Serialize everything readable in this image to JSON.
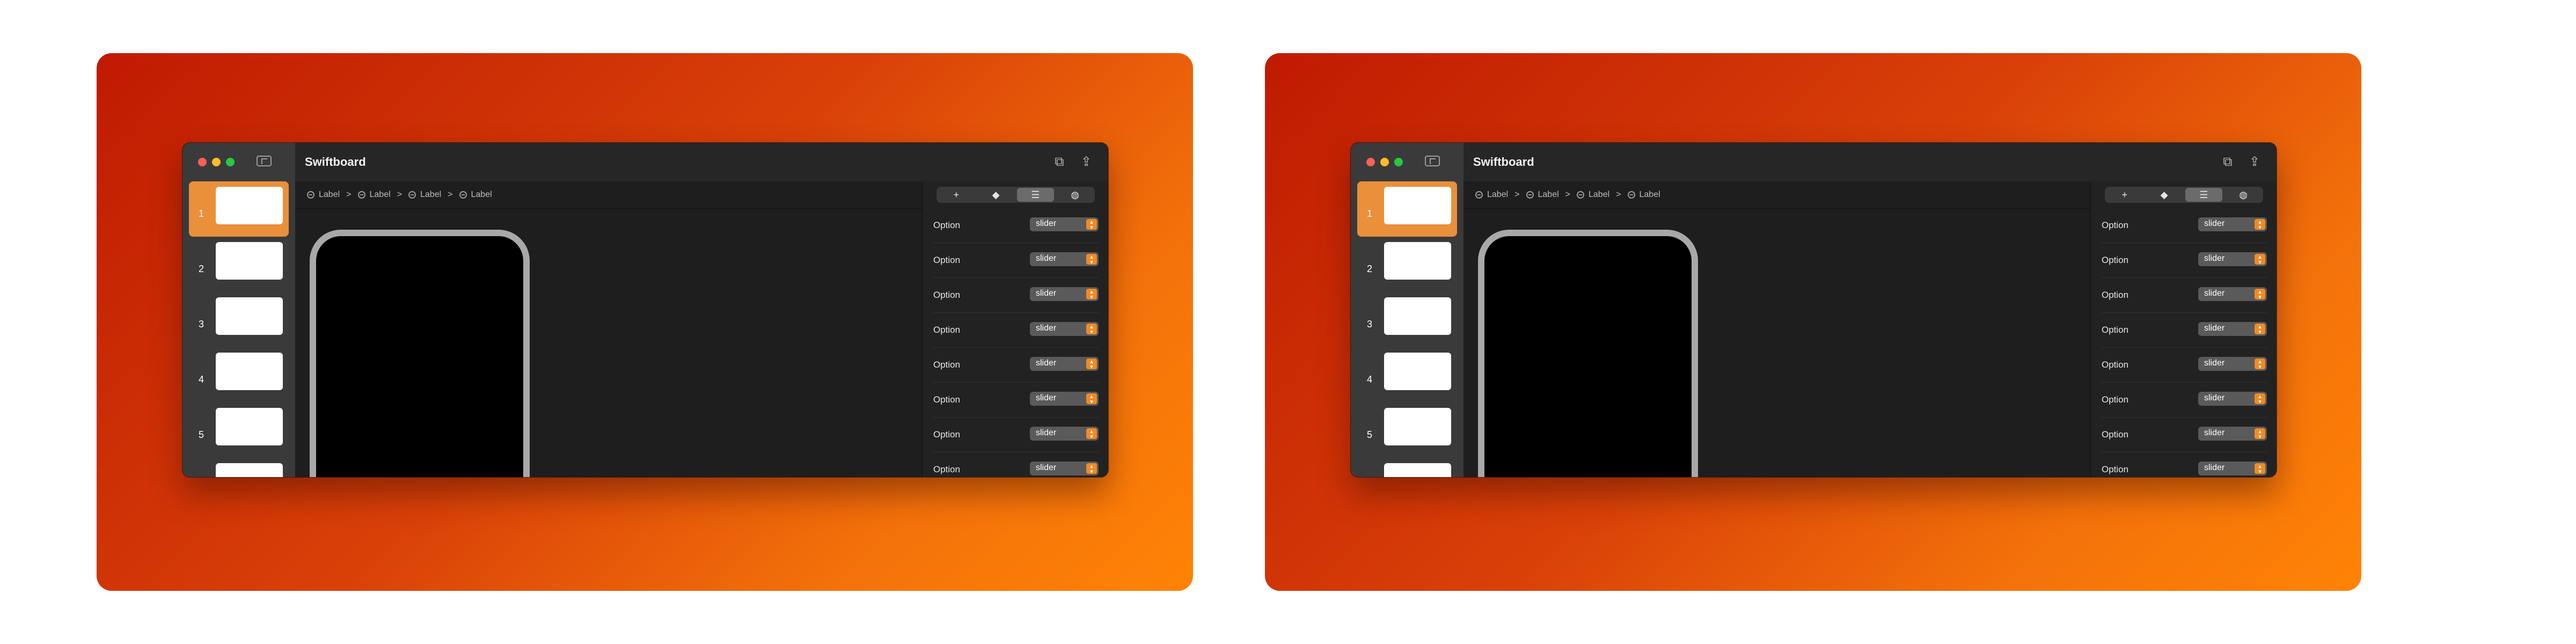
{
  "app": {
    "title": "Swiftboard"
  },
  "sidebar": {
    "slides": [
      {
        "number": "1",
        "active": true
      },
      {
        "number": "2",
        "active": false
      },
      {
        "number": "3",
        "active": false
      },
      {
        "number": "4",
        "active": false
      },
      {
        "number": "5",
        "active": false
      },
      {
        "number": "",
        "active": false
      }
    ]
  },
  "toolbar": {
    "icons": [
      "documents-icon",
      "share-icon"
    ]
  },
  "breadcrumb": {
    "items": [
      "Label",
      "Label",
      "Label",
      "Label"
    ],
    "separator": ">"
  },
  "inspector": {
    "tabs": [
      {
        "icon": "plus-icon",
        "glyph": "+",
        "active": false
      },
      {
        "icon": "layers-icon",
        "glyph": "◆",
        "active": false
      },
      {
        "icon": "list-icon",
        "glyph": "☰",
        "active": true
      },
      {
        "icon": "globe-icon",
        "glyph": "◍",
        "active": false
      }
    ],
    "options": [
      {
        "label": "Option",
        "value": "slider"
      },
      {
        "label": "Option",
        "value": "slider"
      },
      {
        "label": "Option",
        "value": "slider"
      },
      {
        "label": "Option",
        "value": "slider"
      },
      {
        "label": "Option",
        "value": "slider"
      },
      {
        "label": "Option",
        "value": "slider"
      },
      {
        "label": "Option",
        "value": "slider"
      },
      {
        "label": "Option",
        "value": "slider"
      }
    ]
  },
  "colors": {
    "background_gradient": [
      "#c01a02",
      "#ff8306"
    ],
    "accent": "#ea8f3a",
    "window_bg": "#1e1e1e",
    "sidebar_bg": "#3a3a3a"
  }
}
